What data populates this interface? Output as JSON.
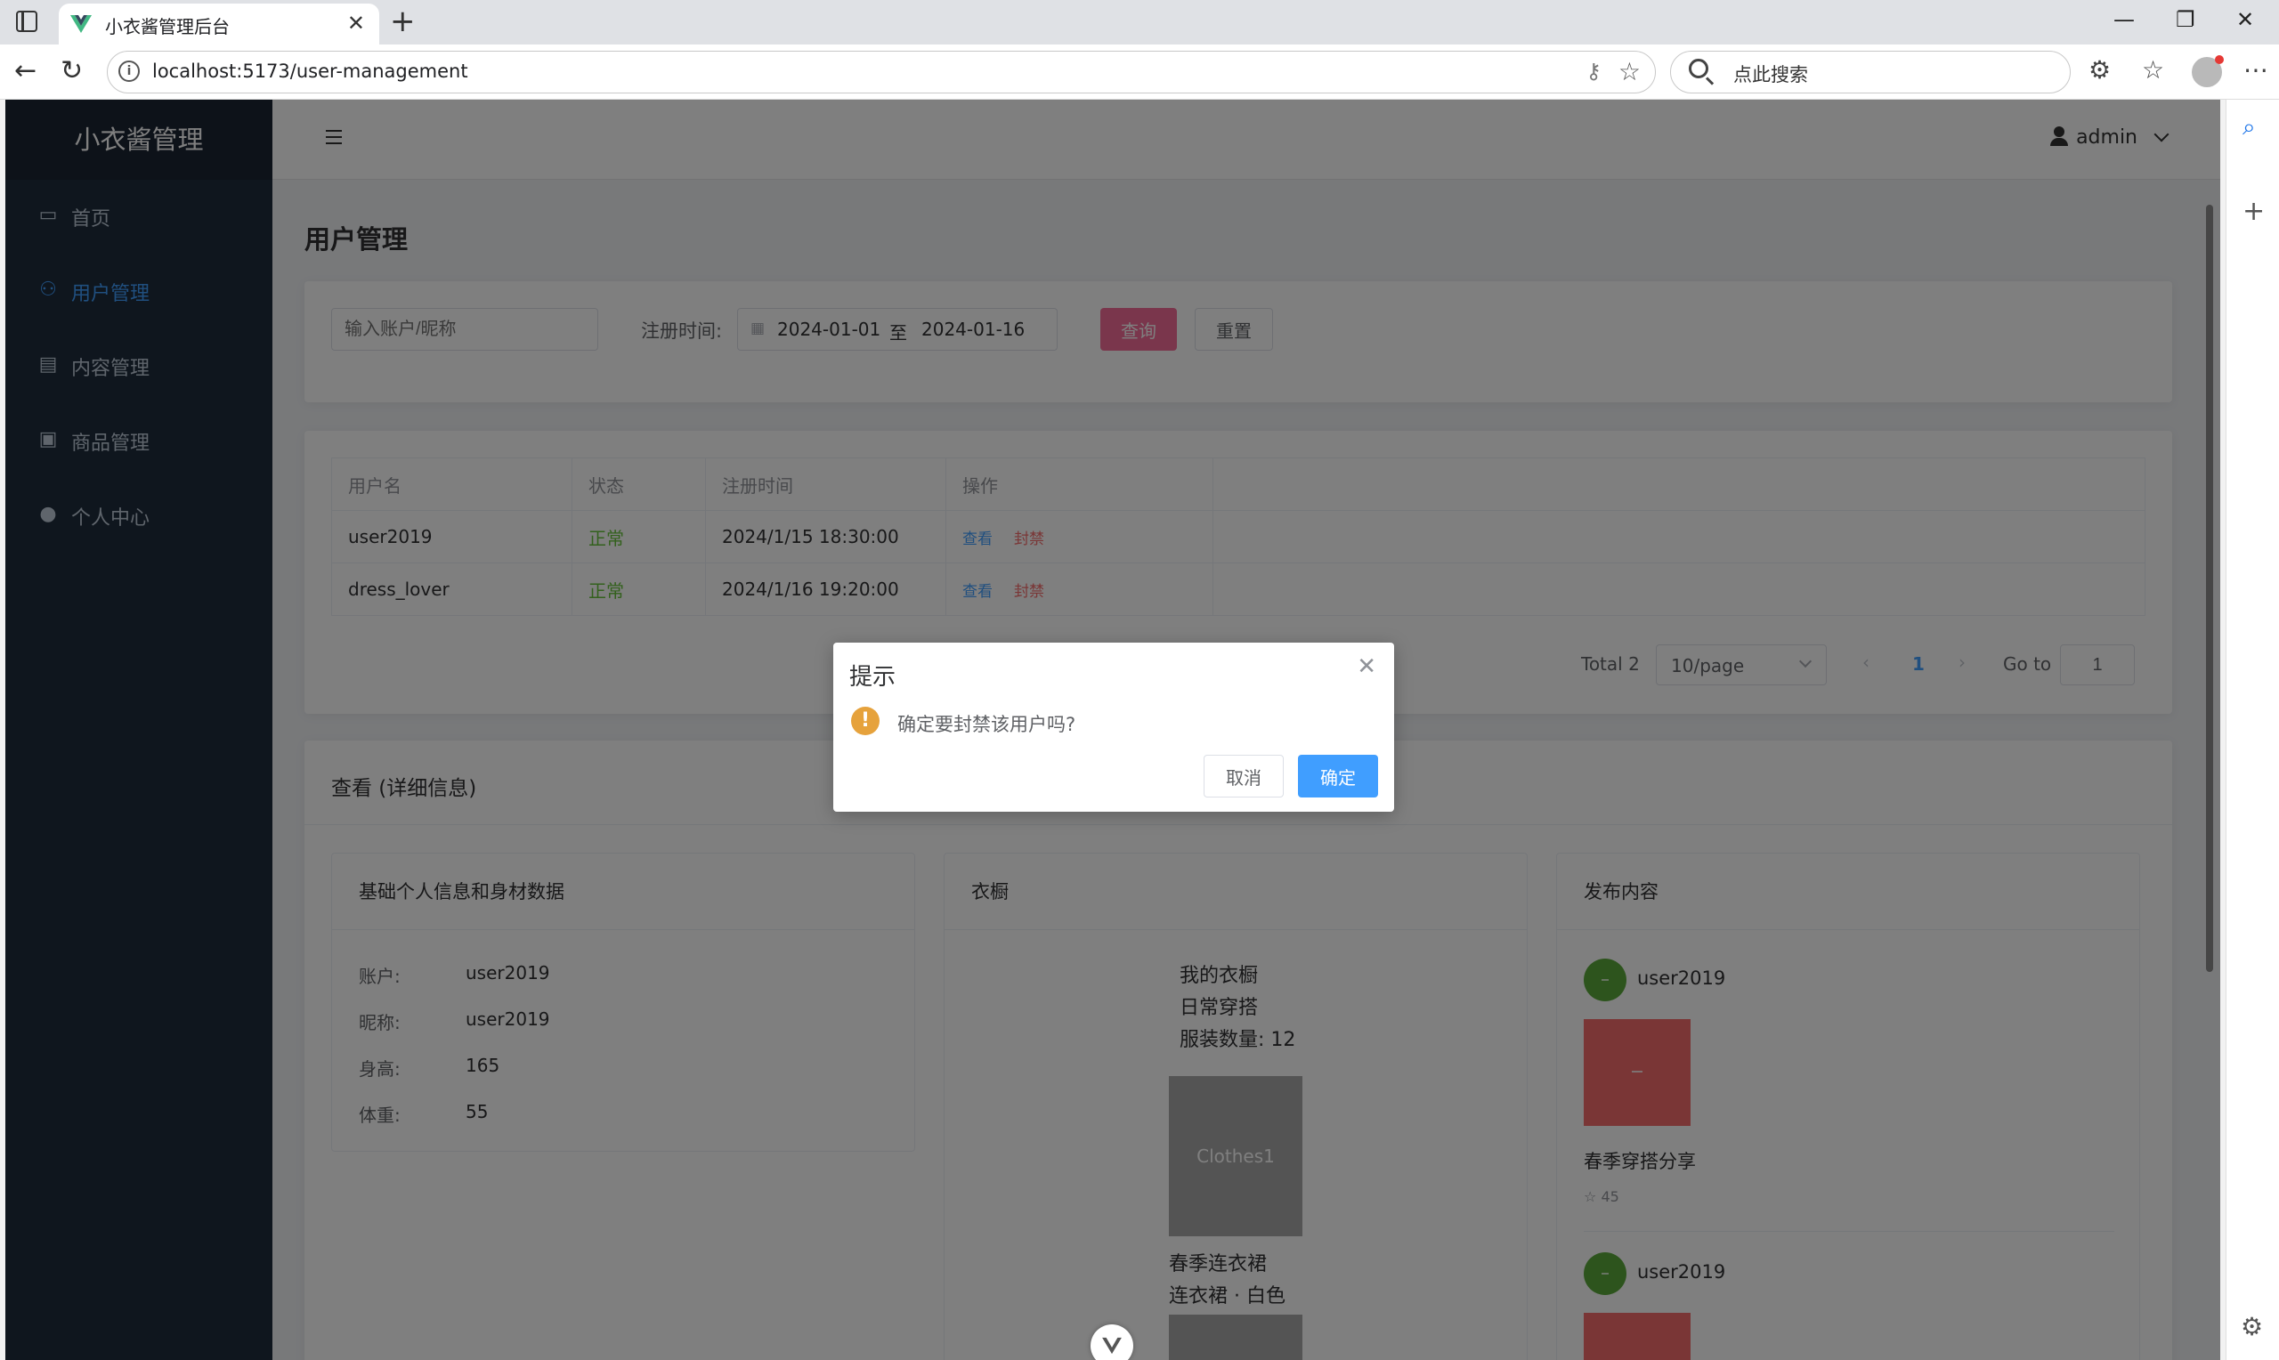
{
  "browser": {
    "tab_title": "小衣酱管理后台",
    "url": "localhost:5173/user-management",
    "search_placeholder": "点此搜索"
  },
  "app": {
    "logo": "小衣酱管理",
    "menu": [
      {
        "label": "首页",
        "icon": "monitor-icon",
        "active": false
      },
      {
        "label": "用户管理",
        "icon": "user-icon",
        "active": true
      },
      {
        "label": "内容管理",
        "icon": "document-icon",
        "active": false
      },
      {
        "label": "商品管理",
        "icon": "goods-icon",
        "active": false
      },
      {
        "label": "个人中心",
        "icon": "avatar-icon",
        "active": false
      }
    ],
    "header_user": "admin"
  },
  "page": {
    "title": "用户管理",
    "filter": {
      "account_placeholder": "输入账户/昵称",
      "date_label": "注册时间:",
      "date_start": "2024-01-01",
      "date_sep": "至",
      "date_end": "2024-01-16",
      "query_label": "查询",
      "reset_label": "重置"
    },
    "table": {
      "headers": [
        "用户名",
        "状态",
        "注册时间",
        "操作"
      ],
      "rows": [
        {
          "username": "user2019",
          "status": "正常",
          "time": "2024/1/15 18:30:00",
          "view": "查看",
          "ban": "封禁"
        },
        {
          "username": "dress_lover",
          "status": "正常",
          "time": "2024/1/16 19:20:00",
          "view": "查看",
          "ban": "封禁"
        }
      ]
    },
    "pagination": {
      "total": "Total 2",
      "page_size": "10/page",
      "current": "1",
      "goto_label": "Go to",
      "goto_value": "1"
    },
    "detail": {
      "title": "查看 (详细信息)",
      "basic": {
        "title": "基础个人信息和身材数据",
        "fields": [
          {
            "label": "账户:",
            "value": "user2019"
          },
          {
            "label": "昵称:",
            "value": "user2019"
          },
          {
            "label": "身高:",
            "value": "165"
          },
          {
            "label": "体重:",
            "value": "55"
          }
        ]
      },
      "wardrobe": {
        "title": "衣橱",
        "name": "我的衣橱",
        "desc": "日常穿搭",
        "count": "服装数量: 12",
        "item_img_text": "Clothes1",
        "item_name": "春季连衣裙",
        "item_desc": "连衣裙 · 白色"
      },
      "posts": {
        "title": "发布内容",
        "items": [
          {
            "user": "user2019",
            "title": "春季穿搭分享",
            "likes": "45"
          },
          {
            "user": "user2019"
          }
        ]
      }
    }
  },
  "dialog": {
    "title": "提示",
    "message": "确定要封禁该用户吗?",
    "cancel": "取消",
    "confirm": "确定"
  },
  "colors": {
    "sidebar_bg": "#1f2d3d",
    "primary": "#409eff",
    "danger": "#f56c6c",
    "success": "#67c23a",
    "query_btn": "#f56c99"
  }
}
